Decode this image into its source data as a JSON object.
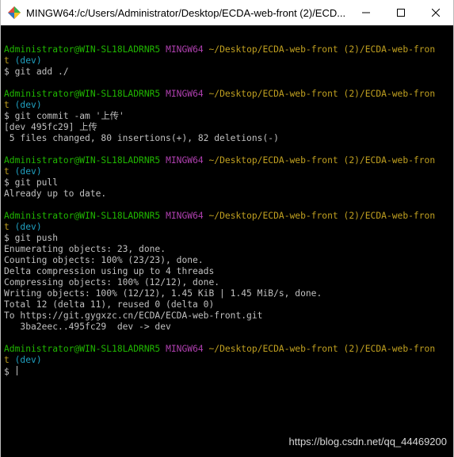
{
  "window": {
    "title": "MINGW64:/c/Users/Administrator/Desktop/ECDA-web-front (2)/ECD...",
    "icon": "git-bash-icon",
    "controls": [
      "minimize-icon",
      "maximize-icon",
      "close-icon"
    ]
  },
  "colors": {
    "background": "#000000",
    "prompt_user": "#20b800",
    "prompt_msystem": "#b040b0",
    "prompt_path": "#c0a020",
    "prompt_branch": "#20a0c0",
    "output": "#c0c0c0"
  },
  "prompt": {
    "user_host": "Administrator@WIN-SL18LADRNR5",
    "msystem": "MINGW64",
    "path_part1": "~/Desktop/ECDA-web-front (2)/ECDA-web-fron",
    "path_part2": "t",
    "branch": "(dev)",
    "symbol": "$"
  },
  "blocks": [
    {
      "command": "git add ./",
      "output": []
    },
    {
      "command": "git commit -am '上传'",
      "output": [
        "[dev 495fc29] 上传",
        " 5 files changed, 80 insertions(+), 82 deletions(-)"
      ]
    },
    {
      "command": "git pull",
      "output": [
        "Already up to date."
      ]
    },
    {
      "command": "git push",
      "output": [
        "Enumerating objects: 23, done.",
        "Counting objects: 100% (23/23), done.",
        "Delta compression using up to 4 threads",
        "Compressing objects: 100% (12/12), done.",
        "Writing objects: 100% (12/12), 1.45 KiB | 1.45 MiB/s, done.",
        "Total 12 (delta 11), reused 0 (delta 0)",
        "To https://git.gygxzc.cn/ECDA/ECDA-web-front.git",
        "   3ba2eec..495fc29  dev -> dev"
      ]
    },
    {
      "command": "",
      "output": []
    }
  ],
  "watermark": "https://blog.csdn.net/qq_44469200"
}
